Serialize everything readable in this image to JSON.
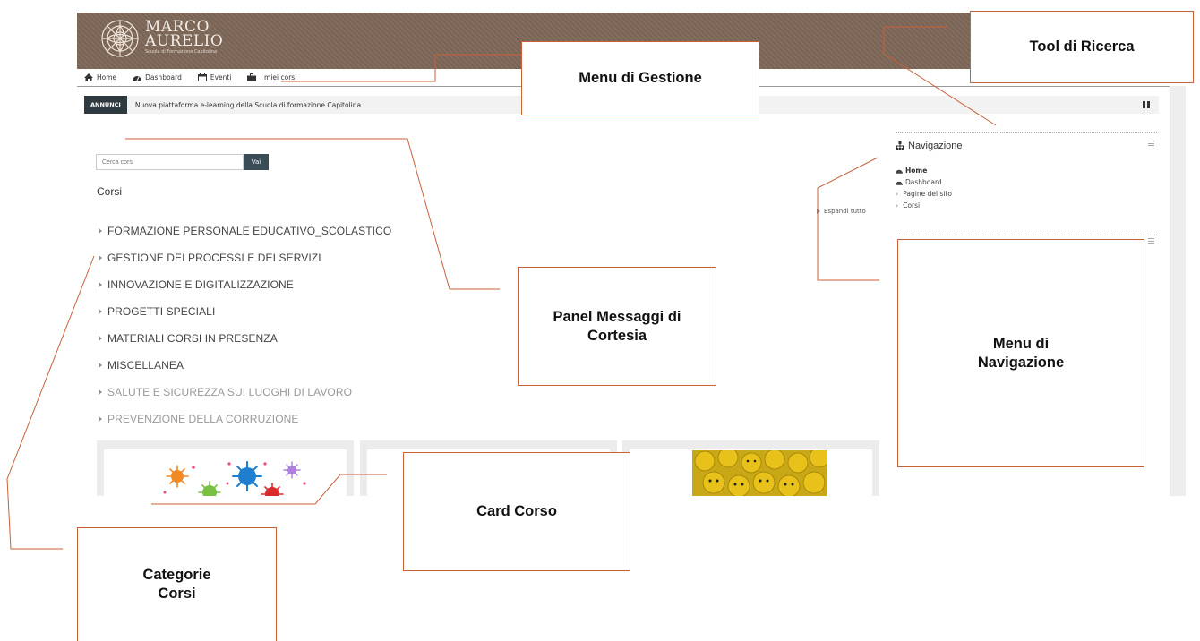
{
  "brand": {
    "name_line1": "MARCO",
    "name_line2": "AURELIO",
    "tagline": "Scuola di Formazione Capitolina"
  },
  "navbar": {
    "items": [
      {
        "label": "Home",
        "icon": "home-icon"
      },
      {
        "label": "Dashboard",
        "icon": "dashboard-icon"
      },
      {
        "label": "Eventi",
        "icon": "calendar-icon"
      },
      {
        "label": "I miei corsi",
        "icon": "briefcase-icon"
      }
    ]
  },
  "announcement": {
    "tag": "ANNUNCI",
    "text": "Nuova piattaforma e-learning della Scuola di formazione Capitolina"
  },
  "search": {
    "placeholder": "Cerca corsi",
    "button": "Vai"
  },
  "courses": {
    "title": "Corsi",
    "expand_all": "Espandi tutto",
    "categories": [
      "FORMAZIONE PERSONALE EDUCATIVO_SCOLASTICO",
      "GESTIONE DEI PROCESSI E DEI SERVIZI",
      "INNOVAZIONE E DIGITALIZZAZIONE",
      "PROGETTI SPECIALI",
      "MATERIALI CORSI IN PRESENZA",
      "MISCELLANEA",
      "SALUTE E SICUREZZA SUI LUOGHI DI LAVORO",
      "PREVENZIONE DELLA CORRUZIONE"
    ]
  },
  "navigation_block": {
    "title": "Navigazione",
    "items": [
      {
        "label": "Home"
      },
      {
        "label": "Dashboard"
      },
      {
        "label": "Pagine del sito"
      },
      {
        "label": "Corsi"
      }
    ]
  },
  "callouts": {
    "menu_gestione": "Menu di Gestione",
    "tool_ricerca": "Tool di Ricerca",
    "panel_messaggi": "Panel Messaggi di Cortesia",
    "menu_navigazione": "Menu di Navigazione",
    "card_corso": "Card Corso",
    "categorie_corsi": "Categorie Corsi"
  },
  "colors": {
    "header_bg": "#7e6757",
    "callout_border": "#c8613a",
    "button_bg": "#3a4d57",
    "announce_tag_bg": "#2f3a40"
  }
}
